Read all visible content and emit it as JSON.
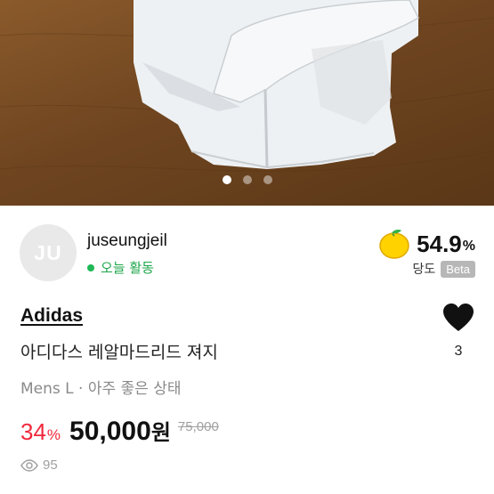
{
  "photo": {
    "dots": [
      true,
      false,
      false
    ]
  },
  "seller": {
    "avatar_initials": "JU",
    "username": "juseungjeil",
    "activity": "오늘 활동",
    "score_value": "54.9",
    "score_unit": "%",
    "sweetness_label": "당도",
    "beta_badge": "Beta"
  },
  "product": {
    "brand": "Adidas",
    "title": "아디다스 레알마드리드 져지",
    "meta": "Mens L · 아주 좋은 상태",
    "like_count": "3",
    "discount": "34",
    "discount_unit": "%",
    "price": "50,000",
    "price_unit": "원",
    "original_price": "75,000",
    "views": "95"
  },
  "colors": {
    "accent_red": "#f0283c",
    "activity_green": "#1fb857",
    "lemon_yellow": "#ffd200"
  }
}
